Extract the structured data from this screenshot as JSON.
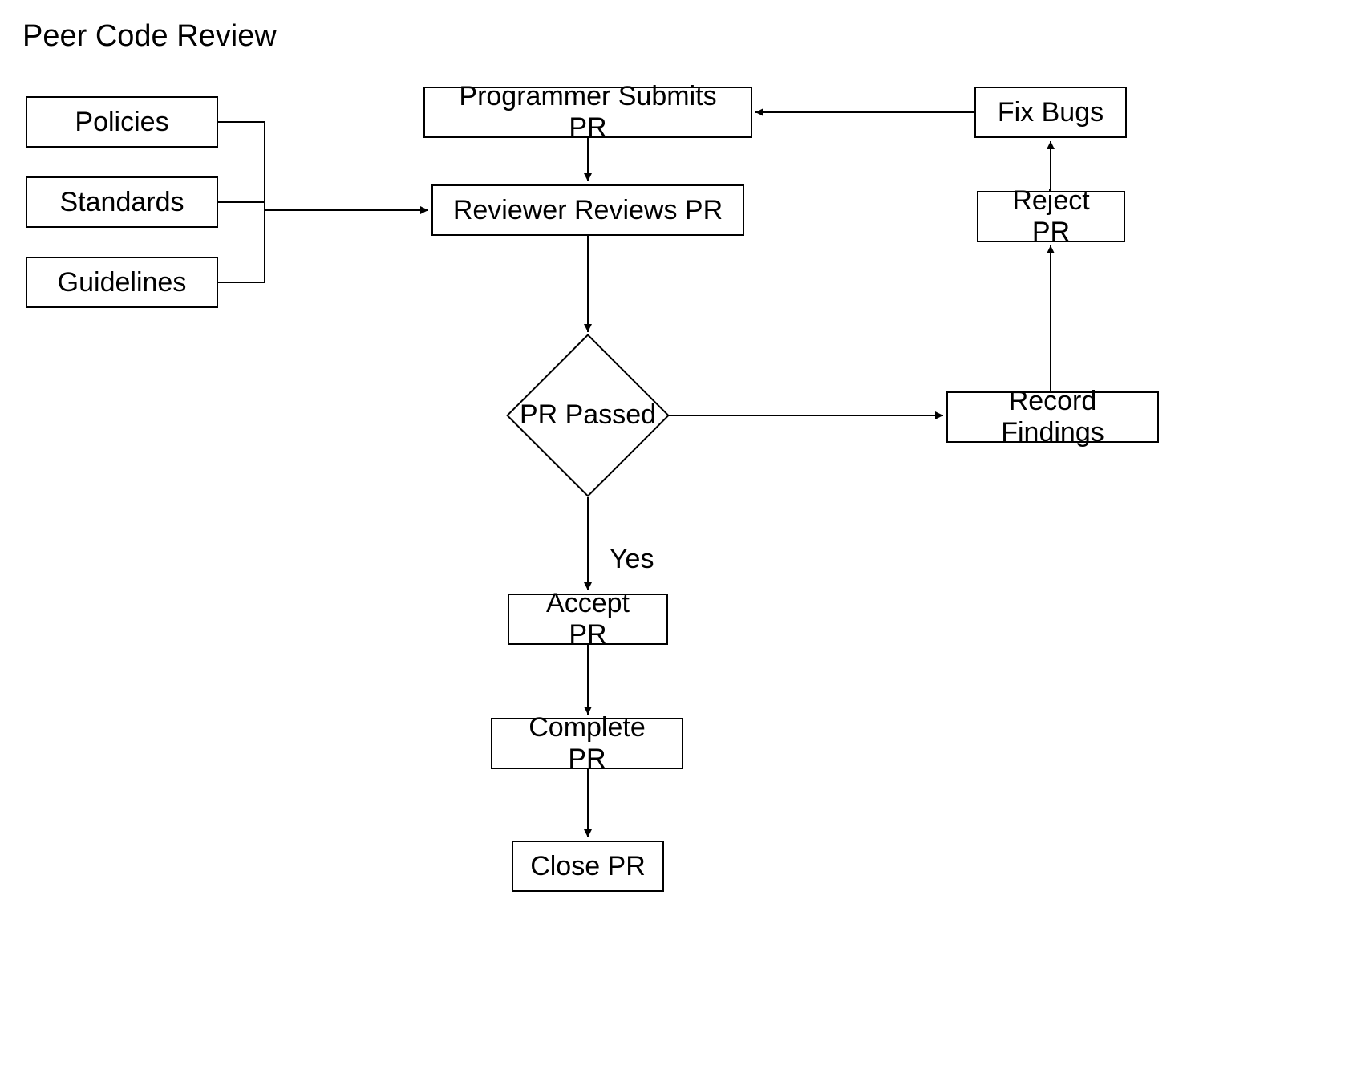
{
  "title": "Peer Code Review",
  "inputs": {
    "policies": "Policies",
    "standards": "Standards",
    "guidelines": "Guidelines"
  },
  "nodes": {
    "submit": "Programmer Submits PR",
    "review": "Reviewer Reviews PR",
    "decision": "PR Passed",
    "accept": "Accept PR",
    "complete": "Complete PR",
    "close": "Close PR",
    "record": "Record Findings",
    "reject": "Reject PR",
    "fix": "Fix Bugs"
  },
  "labels": {
    "yes": "Yes"
  }
}
